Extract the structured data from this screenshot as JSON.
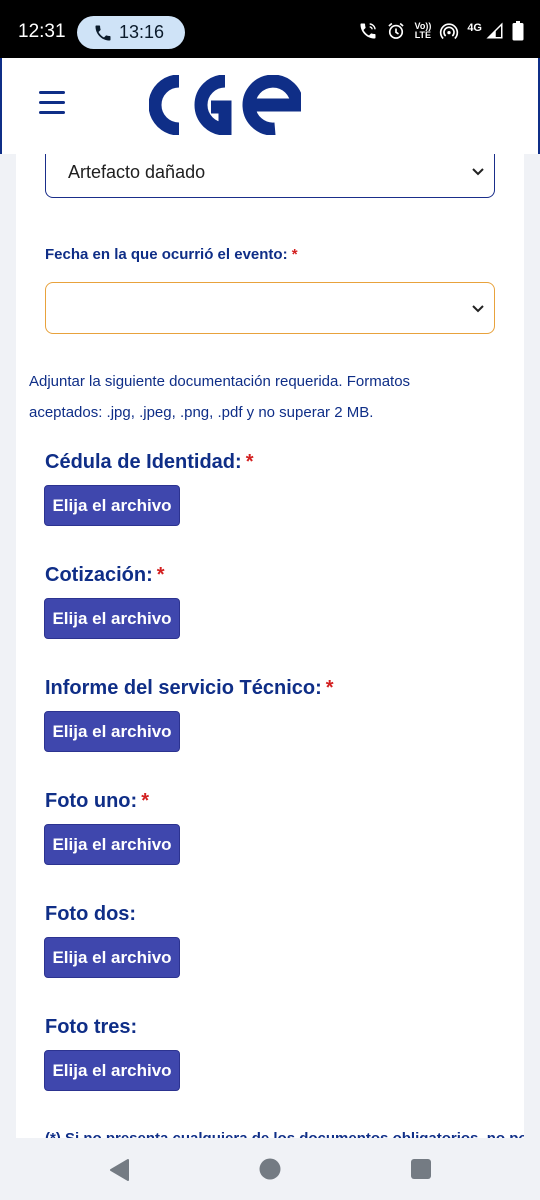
{
  "status_bar": {
    "time": "12:31",
    "call_duration": "13:16",
    "icons": [
      "wifi-calling-icon",
      "alarm-icon",
      "volte-icon",
      "hotspot-icon",
      "4g-signal-icon",
      "battery-icon"
    ],
    "volte_top": "Vo))",
    "volte_bottom": "LTE",
    "network": "4G"
  },
  "header": {
    "logo_text": "CGE",
    "menu_icon": "hamburger-menu-icon",
    "brand_color": "#0f2e87"
  },
  "form": {
    "damage_type_value": "Artefacto dañado",
    "event_date_label": "Fecha en la que ocurrió el evento:",
    "required_mark": "*",
    "event_date_value": "",
    "documents_info_line1": "Adjuntar la siguiente documentación requerida. Formatos",
    "documents_info_line2": "aceptados: .jpg, .jpeg, .png, .pdf y no superar 2 MB.",
    "documents": [
      {
        "label": "Cédula de Identidad:",
        "required": "*",
        "button": "Elija el archivo"
      },
      {
        "label": "Cotización:",
        "required": "*",
        "button": "Elija el archivo"
      },
      {
        "label": "Informe del servicio Técnico:",
        "required": "*",
        "button": "Elija el archivo"
      },
      {
        "label": "Foto uno:",
        "required": "*",
        "button": "Elija el archivo"
      },
      {
        "label": "Foto dos:",
        "required": "",
        "button": "Elija el archivo"
      },
      {
        "label": "Foto tres:",
        "required": "",
        "button": "Elija el archivo"
      }
    ],
    "footnote": "(*) Si no presenta cualquiera de los documentos obligatorios, no podemos"
  },
  "colors": {
    "accent": "#3f47ad",
    "label": "#0f2e87",
    "required": "#d32020",
    "date_border": "#e8a23c"
  }
}
